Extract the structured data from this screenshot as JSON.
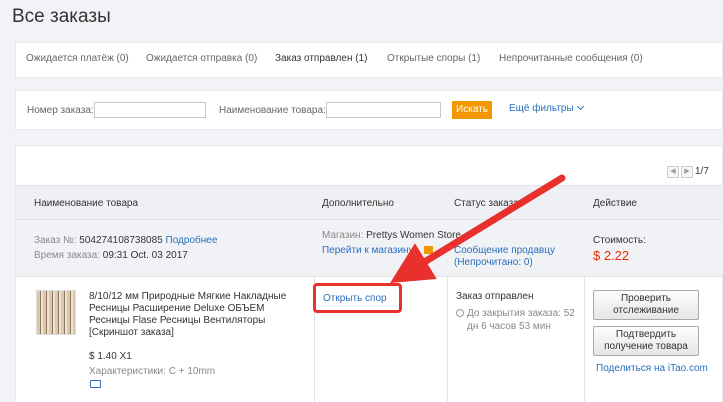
{
  "page": {
    "title": "Все заказы"
  },
  "tabs": [
    {
      "label": "Ожидается платёж (0)"
    },
    {
      "label": "Ожидается отправка (0)"
    },
    {
      "label": "Заказ отправлен (1)"
    },
    {
      "label": "Открытые споры (1)"
    },
    {
      "label": "Непрочитанные сообщения (0)"
    }
  ],
  "filters": {
    "order_no_label": "Номер заказа:",
    "order_no_value": "",
    "product_label": "Наименование товара:",
    "product_value": "",
    "search_label": "Искать",
    "more_label": "Ещё фильтры"
  },
  "pager": {
    "prev": "◀",
    "next": "▶",
    "text": "1/7"
  },
  "table": {
    "headers": [
      "Наименование товара",
      "Дополнительно",
      "Статус заказа",
      "Действие"
    ]
  },
  "order": {
    "number_label": "Заказ №:",
    "number": "504274108738085",
    "details_link": "Подробнее",
    "time_label": "Время заказа:",
    "time": "09:31 Oct. 03 2017",
    "store_label": "Магазин:",
    "store": "Prettys Women Store",
    "go_to_store": "Перейти к магазину",
    "message_line1": "Сообщение продавцу",
    "message_line2": "(Непрочитано: 0)",
    "cost_label": "Стоимость:",
    "cost": "$ 2.22",
    "product": {
      "name": "8/10/12 мм Природные Мягкие Накладные Ресницы Расширение Deluxe ОБЪЕМ Ресницы Flase Ресницы Вентиляторы",
      "snapshot": "[Скриншот заказа]",
      "price": "$ 1.40 X1",
      "characteristics": "Характеристики: С + 10mm"
    },
    "open_dispute": "Открыть спор",
    "status": "Заказ отправлен",
    "close_countdown": "До закрытия заказа: 52 дн 6 часов 53 мин",
    "track_button": "Проверить отслеживание",
    "confirm_button": "Подтвердить получение товара",
    "share_label": "Поделиться на iTao.com"
  },
  "colors": {
    "accent_orange": "#f39700",
    "link_blue": "#2a6ebb",
    "price_red": "#e62e04",
    "highlight_red": "#e8312d"
  }
}
